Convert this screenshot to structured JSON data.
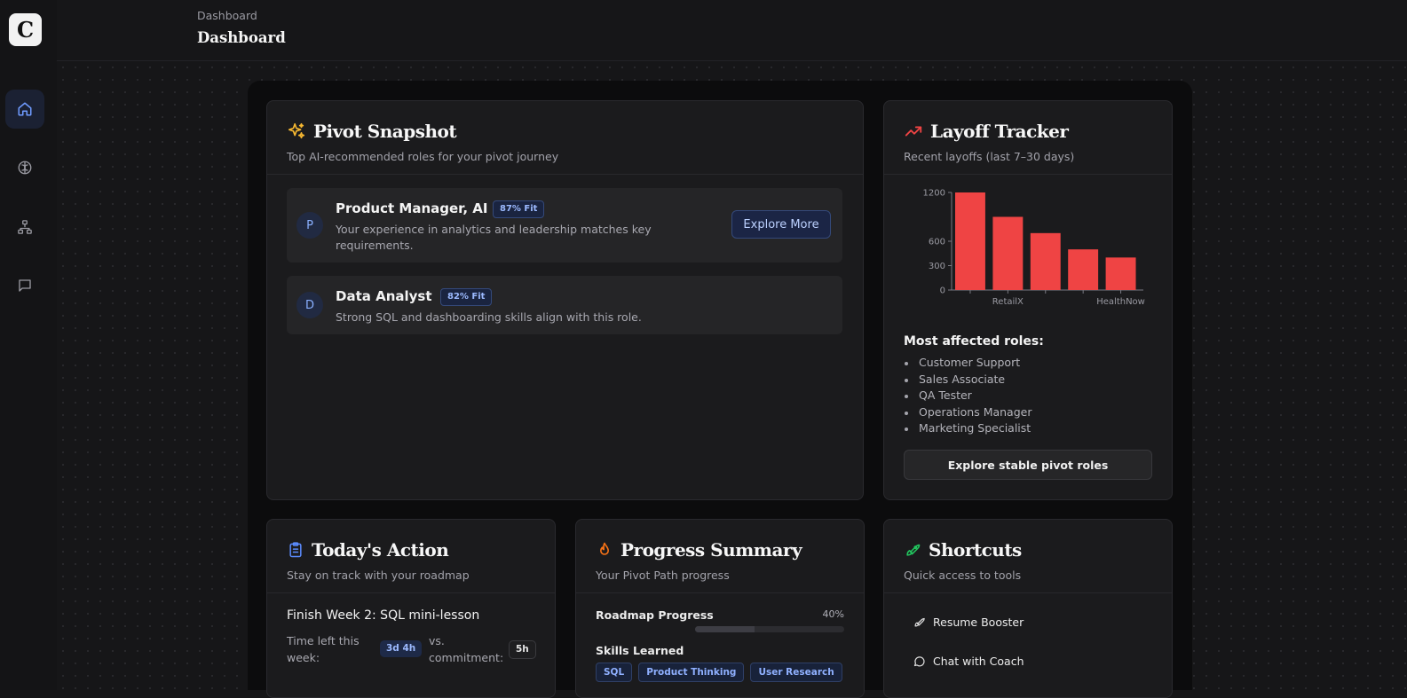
{
  "app": {
    "logo_letter": "C"
  },
  "sidebar": {
    "items": [
      {
        "icon": "home-icon",
        "active": true
      },
      {
        "icon": "brain-icon",
        "active": false
      },
      {
        "icon": "org-chart-icon",
        "active": false
      },
      {
        "icon": "chat-icon",
        "active": false
      }
    ]
  },
  "header": {
    "breadcrumb": "Dashboard",
    "title": "Dashboard"
  },
  "pivot_snapshot": {
    "title": "Pivot Snapshot",
    "subtitle": "Top AI-recommended roles for your pivot journey",
    "icon": "sparkles-icon",
    "roles": [
      {
        "initial": "P",
        "name": "Product Manager, AI",
        "fit": "87% Fit",
        "description": "Your experience in analytics and leadership matches key requirements.",
        "button": "Explore More"
      },
      {
        "initial": "D",
        "name": "Data Analyst",
        "fit": "82% Fit",
        "description": "Strong SQL and dashboarding skills align with this role."
      }
    ]
  },
  "layoff_tracker": {
    "title": "Layoff Tracker",
    "subtitle": "Recent layoffs (last 7–30 days)",
    "icon": "trending-up-icon",
    "most_affected_title": "Most affected roles:",
    "most_affected": [
      "Customer Support",
      "Sales Associate",
      "QA Tester",
      "Operations Manager",
      "Marketing Specialist"
    ],
    "button": "Explore stable pivot roles"
  },
  "chart_data": {
    "type": "bar",
    "categories": [
      "",
      "RetailX",
      "",
      "",
      "HealthNow"
    ],
    "values": [
      1200,
      900,
      700,
      500,
      400
    ],
    "yticks": [
      0,
      300,
      600,
      1200
    ],
    "ylim": [
      0,
      1200
    ],
    "bar_color": "#ef4444",
    "grid": false
  },
  "todays_action": {
    "title": "Today's Action",
    "subtitle": "Stay on track with your roadmap",
    "icon": "clipboard-icon",
    "task": "Finish Week 2: SQL mini-lesson",
    "time_left_label_1": "Time left this",
    "time_left_label_2": "week:",
    "time_left_value": "3d 4h",
    "vs_label_1": "vs.",
    "vs_label_2": "commitment:",
    "commitment_value": "5h"
  },
  "progress_summary": {
    "title": "Progress Summary",
    "subtitle": "Your Pivot Path progress",
    "icon": "flame-icon",
    "roadmap_label": "Roadmap Progress",
    "roadmap_percent_text": "40%",
    "roadmap_percent": 40,
    "skills_label": "Skills Learned",
    "skills": [
      "SQL",
      "Product Thinking",
      "User Research"
    ]
  },
  "shortcuts": {
    "title": "Shortcuts",
    "subtitle": "Quick access to tools",
    "icon": "rocket-icon",
    "items": [
      {
        "label": "Resume Booster",
        "icon": "rocket-icon"
      },
      {
        "label": "Chat with Coach",
        "icon": "chat-bubble-icon"
      }
    ]
  },
  "colors": {
    "accent_blue": "#5b8cff",
    "danger_red": "#ef4444",
    "amber": "#f5b731",
    "orange": "#f97316",
    "green": "#22c55e"
  }
}
